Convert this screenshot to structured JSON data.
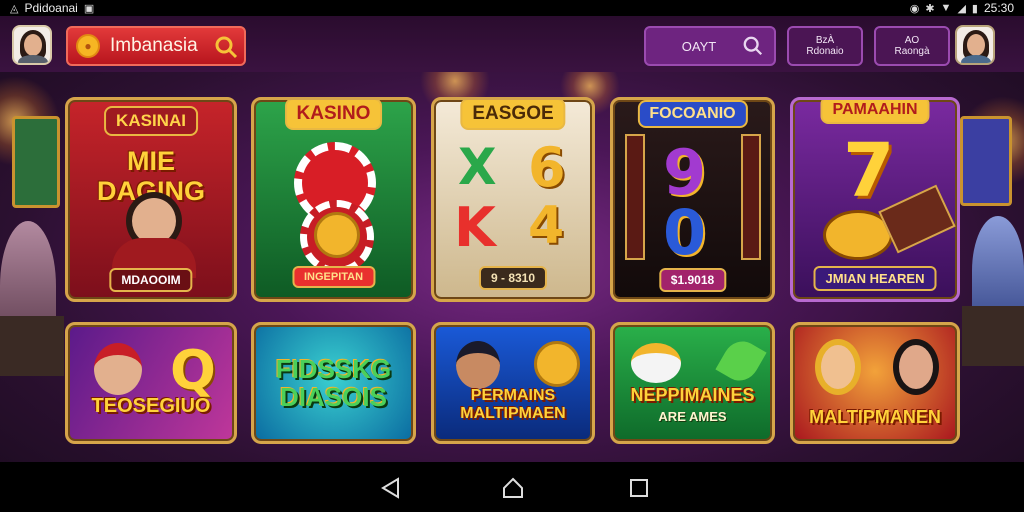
{
  "status_bar": {
    "app_text": "Pdidoanai",
    "time": "25:30"
  },
  "header": {
    "brand_name": "Imbanasia",
    "search_label": "OAYT",
    "button_1": "BzÀ\nRdonaio",
    "button_2": "AO\nRaongà",
    "icons": {
      "brand_logo": "coin-logo-icon",
      "brand_search": "search-icon",
      "search": "search-icon"
    }
  },
  "games_row_1": [
    {
      "sign": "KASINAI",
      "title": "MIE\nDAGING",
      "plate": "MDAOOIM"
    },
    {
      "sign": "KASINO",
      "plate": "INGEPITAN"
    },
    {
      "sign": "EASGOE",
      "reel_1": "X",
      "reel_2": "6",
      "reel_3": "K",
      "reel_4": "4",
      "plate": "9 - 8310"
    },
    {
      "sign": "FOCOANIO",
      "reel_1": "9",
      "reel_2": "0",
      "plate": "$1.9018"
    },
    {
      "sign": "PAMAAHIN",
      "big": "7",
      "plate": "JMIAN HEAREN"
    }
  ],
  "games_row_2": [
    {
      "title": "TEOSEGIUO",
      "big": "Q"
    },
    {
      "title": "FIDSSKG\nDIASOIS"
    },
    {
      "title": "PERMAINS\nMALTIPMAEN"
    },
    {
      "title": "NEPPIMAINES",
      "subtitle": "ARE AMES"
    },
    {
      "title": "MALTIPMANEN"
    }
  ],
  "colors": {
    "gold": "#d6a54a",
    "brand_red": "#c81e26",
    "header_purple": "#5e1a6a"
  }
}
